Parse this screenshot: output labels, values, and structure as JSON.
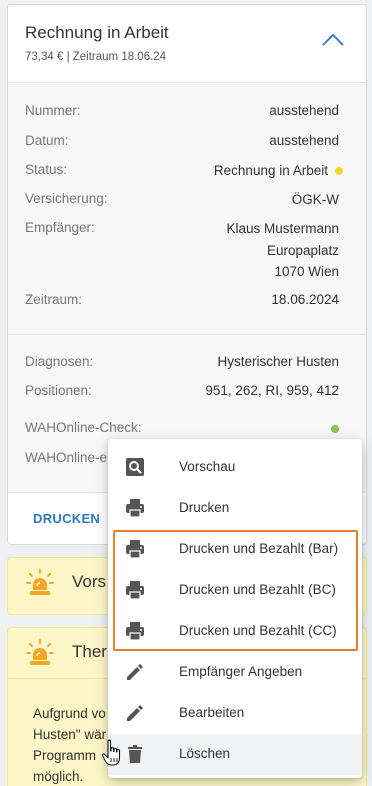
{
  "card": {
    "title": "Rechnung in Arbeit",
    "subtitle": "73,34 € | Zeitraum 18.06.24",
    "fields": [
      {
        "label": "Nummer:",
        "value": "ausstehend"
      },
      {
        "label": "Datum:",
        "value": "ausstehend"
      },
      {
        "label": "Status:",
        "value": "Rechnung in Arbeit"
      },
      {
        "label": "Versicherung:",
        "value": "ÖGK-W"
      },
      {
        "label": "Empfänger:",
        "value_lines": [
          "Klaus Mustermann",
          "Europaplatz",
          "1070 Wien"
        ]
      },
      {
        "label": "Zeitraum:",
        "value": "18.06.2024"
      },
      {
        "label": "Diagnosen:",
        "value": "Hysterischer Husten"
      },
      {
        "label": "Positionen:",
        "value": "951, 262, RI, 959, 412"
      },
      {
        "label": "WAHOnline-Check:"
      },
      {
        "label": "WAHOnline-e"
      }
    ],
    "status_color": "#f2d42e",
    "check_color": "#8bc34a",
    "footer_action": "DRUCKEN"
  },
  "alerts": [
    {
      "title": "Vors"
    },
    {
      "title": "Ther",
      "text_lines": [
        "Aufgrund vo",
        "Husten\" wär",
        "Programm",
        "möglich."
      ]
    }
  ],
  "menu": {
    "items": [
      {
        "label": "Vorschau",
        "icon": "search-icon"
      },
      {
        "label": "Drucken",
        "icon": "printer-icon"
      },
      {
        "label": "Drucken und Bezahlt (Bar)",
        "icon": "printer-icon"
      },
      {
        "label": "Drucken und Bezahlt (BC)",
        "icon": "printer-icon"
      },
      {
        "label": "Drucken und Bezahlt (CC)",
        "icon": "printer-icon"
      },
      {
        "label": "Empfänger Angeben",
        "icon": "pencil-icon"
      },
      {
        "label": "Bearbeiten",
        "icon": "pencil-icon"
      },
      {
        "label": "Löschen",
        "icon": "trash-icon"
      }
    ],
    "hovered": "Löschen"
  },
  "colors": {
    "accent": "#2b79c2",
    "highlight": "#e2812b",
    "alert_bg": "#fdf7c8",
    "alert_icon": "#f5a623"
  }
}
